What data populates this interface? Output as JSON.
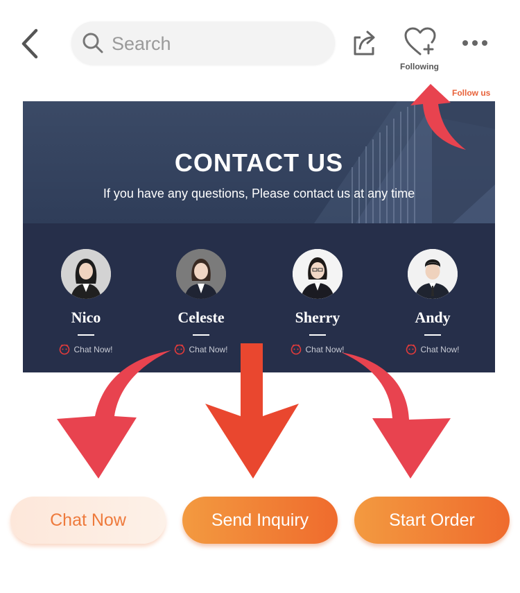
{
  "header": {
    "search_placeholder": "Search",
    "following_label": "Following"
  },
  "annotation": {
    "follow_us": "Follow us"
  },
  "banner": {
    "title": "CONTACT US",
    "subtitle": "If you have any questions, Please contact us at any time"
  },
  "contacts": [
    {
      "name": "Nico",
      "chat_label": "Chat Now!"
    },
    {
      "name": "Celeste",
      "chat_label": "Chat Now!"
    },
    {
      "name": "Sherry",
      "chat_label": "Chat Now!"
    },
    {
      "name": "Andy",
      "chat_label": "Chat Now!"
    }
  ],
  "actions": {
    "chat_now": "Chat Now",
    "send_inquiry": "Send Inquiry",
    "start_order": "Start Order"
  },
  "colors": {
    "accent": "#ef6b2d",
    "arrow_red": "#e8434f",
    "banner_bg": "#262f4a"
  },
  "icons": [
    "back-arrow-icon",
    "search-icon",
    "share-icon",
    "heart-plus-icon",
    "more-dots-icon",
    "chat-bubble-icon"
  ]
}
